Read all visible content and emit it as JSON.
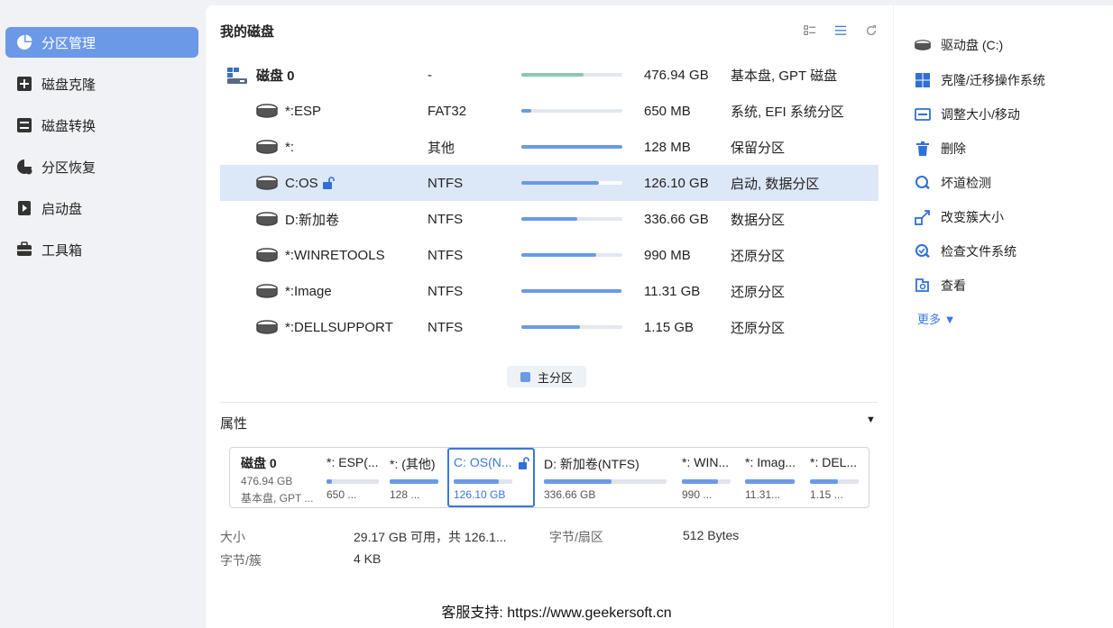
{
  "sidebar": {
    "items": [
      {
        "label": "分区管理",
        "icon": "pie-chart-icon"
      },
      {
        "label": "磁盘克隆",
        "icon": "disk-clone-icon"
      },
      {
        "label": "磁盘转换",
        "icon": "disk-convert-icon"
      },
      {
        "label": "分区恢复",
        "icon": "partition-recovery-icon"
      },
      {
        "label": "启动盘",
        "icon": "boot-disk-icon"
      },
      {
        "label": "工具箱",
        "icon": "toolbox-icon"
      }
    ]
  },
  "main": {
    "title": "我的磁盘",
    "disk": {
      "name": "磁盘 0",
      "fs": "-",
      "size": "476.94 GB",
      "type": "基本盘, GPT 磁盘",
      "used_fraction": 0.62
    },
    "partitions": [
      {
        "name": "*:ESP",
        "fs": "FAT32",
        "size": "650 MB",
        "type": "系统, EFI 系统分区",
        "used_fraction": 0.1
      },
      {
        "name": "*:",
        "fs": "其他",
        "size": "128 MB",
        "type": "保留分区",
        "used_fraction": 1.0
      },
      {
        "name": "C:OS",
        "fs": "NTFS",
        "size": "126.10 GB",
        "type": "启动, 数据分区",
        "used_fraction": 0.77
      },
      {
        "name": "D:新加卷",
        "fs": "NTFS",
        "size": "336.66 GB",
        "type": "数据分区",
        "used_fraction": 0.55
      },
      {
        "name": "*:WINRETOOLS",
        "fs": "NTFS",
        "size": "990 MB",
        "type": "还原分区",
        "used_fraction": 0.74
      },
      {
        "name": "*:Image",
        "fs": "NTFS",
        "size": "11.31 GB",
        "type": "还原分区",
        "used_fraction": 0.99
      },
      {
        "name": "*:DELLSUPPORT",
        "fs": "NTFS",
        "size": "1.15 GB",
        "type": "还原分区",
        "used_fraction": 0.58
      }
    ],
    "legend": "主分区"
  },
  "properties": {
    "title": "属性",
    "map": {
      "disk": {
        "name": "磁盘 0",
        "size": "476.94 GB",
        "type": "基本盘, GPT ..."
      },
      "segments": [
        {
          "label": "*: ESP(...",
          "size": "650 ...",
          "used_fraction": 0.1
        },
        {
          "label": "*: (其他)",
          "size": "128 ...",
          "used_fraction": 1.0
        },
        {
          "label": "C: OS(N...",
          "size": "126.10 GB",
          "used_fraction": 0.77
        },
        {
          "label": "D: 新加卷(NTFS)",
          "size": "336.66 GB",
          "used_fraction": 0.55
        },
        {
          "label": "*: WIN...",
          "size": "990 ...",
          "used_fraction": 0.74
        },
        {
          "label": "*: Imag...",
          "size": "11.31...",
          "used_fraction": 0.99
        },
        {
          "label": "*: DEL...",
          "size": "1.15 ...",
          "used_fraction": 0.58
        }
      ]
    },
    "size_label": "大小",
    "size_value": "29.17 GB 可用，共 126.1...",
    "sector_label": "字节/扇区",
    "sector_value": "512 Bytes",
    "cluster_label": "字节/簇",
    "cluster_value": "4 KB"
  },
  "right": {
    "drive_title": "驱动盘 (C:)",
    "actions": [
      {
        "label": "克隆/迁移操作系统",
        "icon": "windows-icon"
      },
      {
        "label": "调整大小/移动",
        "icon": "resize-move-icon"
      },
      {
        "label": "删除",
        "icon": "trash-icon"
      },
      {
        "label": "坏道检测",
        "icon": "bad-sector-scan-icon"
      },
      {
        "label": "改变簇大小",
        "icon": "cluster-size-icon"
      },
      {
        "label": "检查文件系统",
        "icon": "check-filesystem-icon"
      },
      {
        "label": "查看",
        "icon": "explore-icon"
      }
    ],
    "more": "更多 ▼"
  },
  "footer": "客服支持: https://www.geekersoft.cn",
  "colors": {
    "accent": "#6b99e8",
    "bar": "#6a9ae6",
    "disk_bar": "#8ec8b0",
    "selected_row": "#dce7f8"
  }
}
